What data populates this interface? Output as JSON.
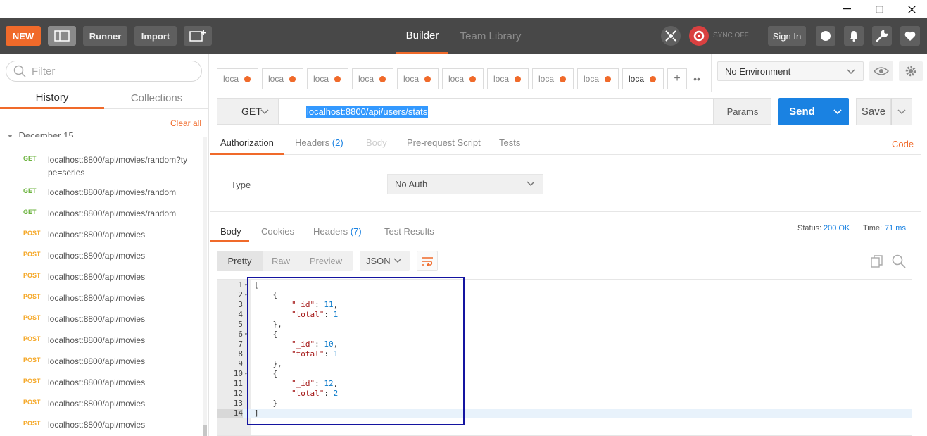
{
  "toolbar": {
    "new_label": "NEW",
    "runner_label": "Runner",
    "import_label": "Import",
    "builder_label": "Builder",
    "team_library_label": "Team Library",
    "sync_label": "SYNC OFF",
    "sign_in_label": "Sign In"
  },
  "sidebar": {
    "filter_placeholder": "Filter",
    "tabs": {
      "history": "History",
      "collections": "Collections"
    },
    "clear_all": "Clear all",
    "date_header": "December 15",
    "items": [
      {
        "method": "GET",
        "url": "localhost:8800/api/movies/random?type=series"
      },
      {
        "method": "GET",
        "url": "localhost:8800/api/movies/random"
      },
      {
        "method": "GET",
        "url": "localhost:8800/api/movies/random"
      },
      {
        "method": "POST",
        "url": "localhost:8800/api/movies"
      },
      {
        "method": "POST",
        "url": "localhost:8800/api/movies"
      },
      {
        "method": "POST",
        "url": "localhost:8800/api/movies"
      },
      {
        "method": "POST",
        "url": "localhost:8800/api/movies"
      },
      {
        "method": "POST",
        "url": "localhost:8800/api/movies"
      },
      {
        "method": "POST",
        "url": "localhost:8800/api/movies"
      },
      {
        "method": "POST",
        "url": "localhost:8800/api/movies"
      },
      {
        "method": "POST",
        "url": "localhost:8800/api/movies"
      },
      {
        "method": "POST",
        "url": "localhost:8800/api/movies"
      },
      {
        "method": "POST",
        "url": "localhost:8800/api/movies"
      }
    ]
  },
  "request_tabs": [
    "loca",
    "loca",
    "loca",
    "loca",
    "loca",
    "loca",
    "loca",
    "loca",
    "loca",
    "loca"
  ],
  "environment": {
    "selected": "No Environment"
  },
  "request": {
    "method": "GET",
    "url": "localhost:8800/api/users/stats",
    "params_label": "Params",
    "send_label": "Send",
    "save_label": "Save",
    "tabs": {
      "authorization": "Authorization",
      "headers": "Headers",
      "headers_count": "(2)",
      "body": "Body",
      "prerequest": "Pre-request Script",
      "tests": "Tests"
    },
    "code_label": "Code",
    "auth_type_label": "Type",
    "auth_type_value": "No Auth"
  },
  "response": {
    "tabs": {
      "body": "Body",
      "cookies": "Cookies",
      "headers": "Headers",
      "headers_count": "(7)",
      "test_results": "Test Results"
    },
    "status_label": "Status:",
    "status_value": "200 OK",
    "time_label": "Time:",
    "time_value": "71 ms",
    "formats": {
      "pretty": "Pretty",
      "raw": "Raw",
      "preview": "Preview"
    },
    "language": "JSON",
    "lines": [
      {
        "n": "1",
        "fold": true,
        "text": "["
      },
      {
        "n": "2",
        "fold": true,
        "text": "    {"
      },
      {
        "n": "3",
        "fold": false,
        "key": "\"_id\"",
        "val": "11",
        "trail": ",",
        "indent": "        "
      },
      {
        "n": "4",
        "fold": false,
        "key": "\"total\"",
        "val": "1",
        "trail": "",
        "indent": "        "
      },
      {
        "n": "5",
        "fold": false,
        "text": "    },"
      },
      {
        "n": "6",
        "fold": true,
        "text": "    {"
      },
      {
        "n": "7",
        "fold": false,
        "key": "\"_id\"",
        "val": "10",
        "trail": ",",
        "indent": "        "
      },
      {
        "n": "8",
        "fold": false,
        "key": "\"total\"",
        "val": "1",
        "trail": "",
        "indent": "        "
      },
      {
        "n": "9",
        "fold": false,
        "text": "    },"
      },
      {
        "n": "10",
        "fold": true,
        "text": "    {"
      },
      {
        "n": "11",
        "fold": false,
        "key": "\"_id\"",
        "val": "12",
        "trail": ",",
        "indent": "        "
      },
      {
        "n": "12",
        "fold": false,
        "key": "\"total\"",
        "val": "2",
        "trail": "",
        "indent": "        "
      },
      {
        "n": "13",
        "fold": false,
        "text": "    }"
      },
      {
        "n": "14",
        "fold": false,
        "text": "]"
      }
    ]
  },
  "colors": {
    "accent": "#f06a2a",
    "send_blue": "#1a82e2",
    "get_green": "#6cb33f",
    "post_orange": "#f5a623",
    "annotation_box": "#1414a0"
  }
}
